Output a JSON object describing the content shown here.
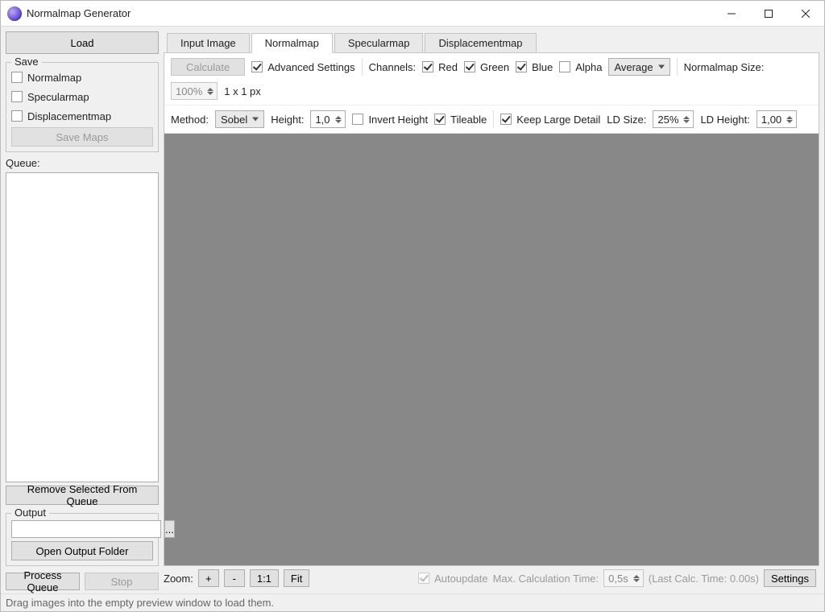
{
  "app": {
    "title": "Normalmap Generator"
  },
  "left": {
    "load": "Load",
    "save_group": "Save",
    "save_opts": {
      "normalmap": "Normalmap",
      "specularmap": "Specularmap",
      "displacementmap": "Displacementmap"
    },
    "save_maps": "Save Maps",
    "queue_label": "Queue:",
    "remove_queue": "Remove Selected From Queue",
    "output_group": "Output",
    "output_path": "",
    "browse": "...",
    "open_output": "Open Output Folder",
    "process_queue": "Process Queue",
    "stop": "Stop"
  },
  "tabs": {
    "input": "Input Image",
    "normal": "Normalmap",
    "spec": "Specularmap",
    "disp": "Displacementmap"
  },
  "row1": {
    "calculate": "Calculate",
    "advanced": "Advanced Settings",
    "channels_label": "Channels:",
    "red": "Red",
    "green": "Green",
    "blue": "Blue",
    "alpha": "Alpha",
    "alpha_mode": "Average",
    "size_label": "Normalmap Size:",
    "size_value": "100%",
    "size_px": "1 x 1 px"
  },
  "row2": {
    "method_label": "Method:",
    "method_value": "Sobel",
    "height_label": "Height:",
    "height_value": "1,0",
    "invert": "Invert Height",
    "tileable": "Tileable",
    "keep_large": "Keep Large Detail",
    "ld_size_label": "LD Size:",
    "ld_size_value": "25%",
    "ld_height_label": "LD Height:",
    "ld_height_value": "1,00"
  },
  "footer": {
    "zoom_label": "Zoom:",
    "plus": "+",
    "minus": "-",
    "one_one": "1:1",
    "fit": "Fit",
    "autoupdate": "Autoupdate",
    "max_calc_label": "Max. Calculation Time:",
    "max_calc_value": "0,5s",
    "last_calc": "(Last Calc. Time: 0.00s)",
    "settings": "Settings"
  },
  "status": "Drag images into the empty preview window to load them."
}
